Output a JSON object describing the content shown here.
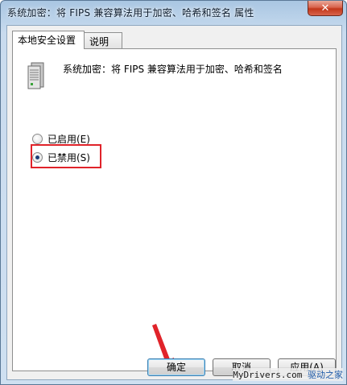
{
  "window": {
    "title": "系统加密：将 FIPS 兼容算法用于加密、哈希和签名 属性",
    "close_glyph": "✕"
  },
  "tabs": [
    {
      "label": "本地安全设置",
      "active": true
    },
    {
      "label": "说明",
      "active": false
    }
  ],
  "policy": {
    "icon": "server-icon",
    "text": "系统加密：将 FIPS 兼容算法用于加密、哈希和签名"
  },
  "options": {
    "enabled_label": "已启用(E)",
    "disabled_label": "已禁用(S)",
    "selected": "disabled"
  },
  "buttons": {
    "ok": "确定",
    "cancel": "取消",
    "apply": "应用(A)"
  },
  "watermark": {
    "site": "MyDrivers.com",
    "name": "驱动之家"
  },
  "colors": {
    "highlight": "#e0232a",
    "arrow": "#e0232a",
    "default_button_border": "#3c7fb1"
  }
}
